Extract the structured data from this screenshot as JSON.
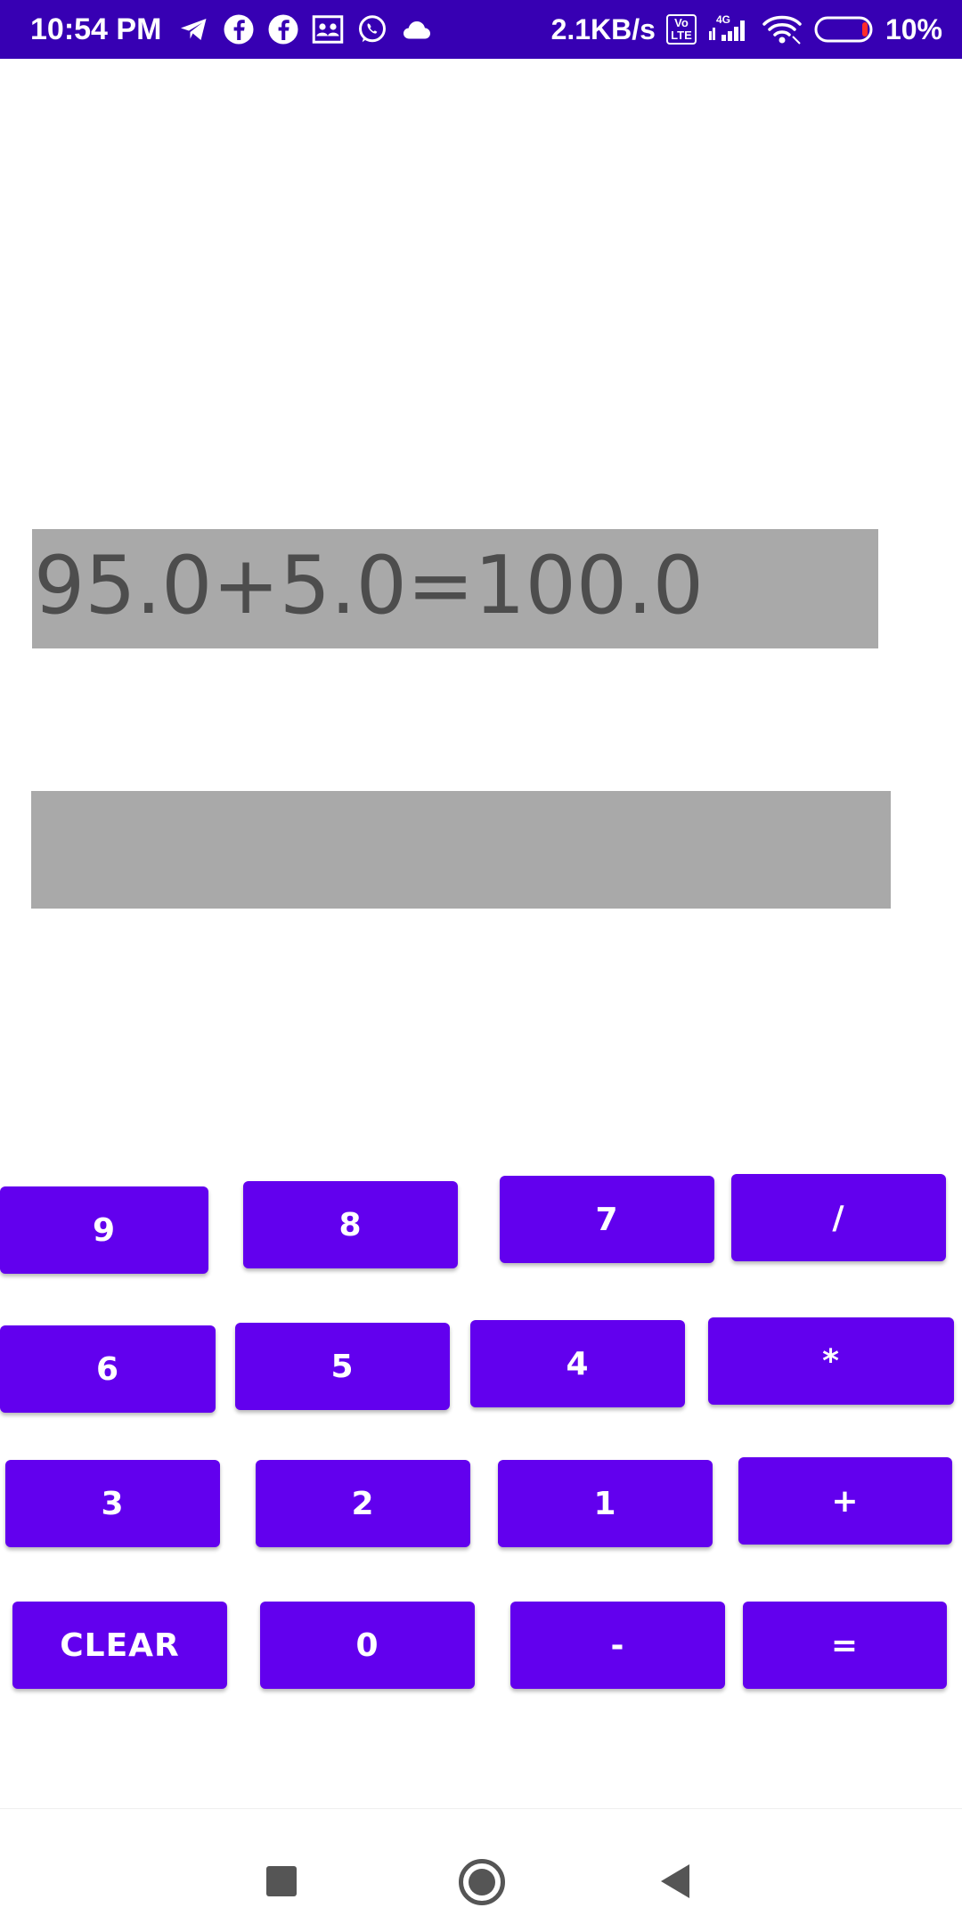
{
  "status_bar": {
    "time": "10:54 PM",
    "notification_icons": [
      "telegram-icon",
      "facebook-icon",
      "facebook-icon",
      "group-icon",
      "whatsapp-icon",
      "cloud-icon"
    ],
    "net_speed": "2.1KB/s",
    "volte": "Vo LTE",
    "network_type": "4G",
    "battery_percent": "10%",
    "colors": {
      "background": "#3700B3",
      "foreground": "#FFFFFF"
    }
  },
  "calculator": {
    "expression_display": "95.0+5.0=100.0",
    "result_display": "",
    "display_background": "#A9A9A9",
    "button_color": "#6200EE",
    "keys": {
      "nine": "9",
      "eight": "8",
      "seven": "7",
      "divide": "/",
      "six": "6",
      "five": "5",
      "four": "4",
      "multiply": "*",
      "three": "3",
      "two": "2",
      "one": "1",
      "plus": "+",
      "clear": "CLEAR",
      "zero": "0",
      "minus": "-",
      "equals": "="
    }
  },
  "nav_bar": {
    "buttons": [
      "recents-icon",
      "home-icon",
      "back-icon"
    ]
  }
}
